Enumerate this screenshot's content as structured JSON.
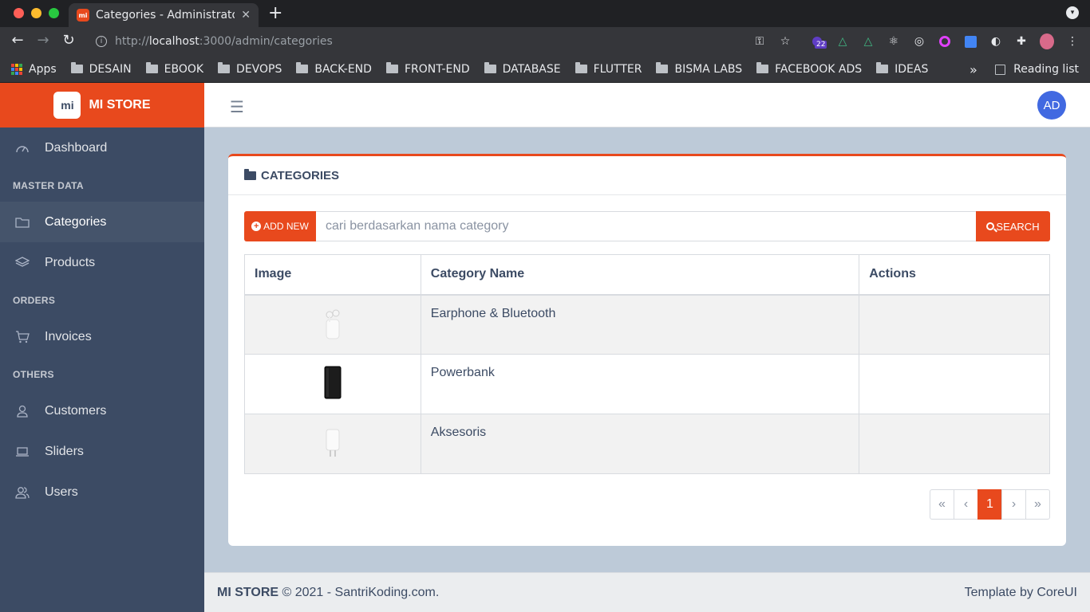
{
  "browser": {
    "tab_title": "Categories - Administrator",
    "tab_favicon": "mi",
    "url_protocol": "http://",
    "url_host": "localhost",
    "url_path": ":3000/admin/categories",
    "extension_badge": "22",
    "bookmarks": [
      {
        "label": "Apps",
        "icon": "apps-grid-icon"
      },
      {
        "label": "DESAIN",
        "icon": "folder-icon"
      },
      {
        "label": "EBOOK",
        "icon": "folder-icon"
      },
      {
        "label": "DEVOPS",
        "icon": "folder-icon"
      },
      {
        "label": "BACK-END",
        "icon": "folder-icon"
      },
      {
        "label": "FRONT-END",
        "icon": "folder-icon"
      },
      {
        "label": "DATABASE",
        "icon": "folder-icon"
      },
      {
        "label": "FLUTTER",
        "icon": "folder-icon"
      },
      {
        "label": "BISMA LABS",
        "icon": "folder-icon"
      },
      {
        "label": "FACEBOOK ADS",
        "icon": "folder-icon"
      },
      {
        "label": "IDEAS",
        "icon": "folder-icon"
      }
    ],
    "more_bookmarks": "»",
    "reading_list": "Reading list"
  },
  "sidebar": {
    "brand_logo": "mi",
    "brand": "MI STORE",
    "dashboard": "Dashboard",
    "section_master": "MASTER DATA",
    "categories": "Categories",
    "products": "Products",
    "section_orders": "ORDERS",
    "invoices": "Invoices",
    "section_others": "OTHERS",
    "customers": "Customers",
    "sliders": "Sliders",
    "users": "Users"
  },
  "header": {
    "menu_icon": "☰",
    "avatar_initials": "AD"
  },
  "card": {
    "title": "CATEGORIES",
    "add_button": "ADD NEW",
    "search_placeholder": "cari berdasarkan nama category",
    "search_button": "SEARCH",
    "columns": [
      "Image",
      "Category Name",
      "Actions"
    ],
    "rows": [
      {
        "image": "earphone-product-image",
        "name": "Earphone & Bluetooth",
        "actions": ""
      },
      {
        "image": "powerbank-product-image",
        "name": "Powerbank",
        "actions": ""
      },
      {
        "image": "charger-product-image",
        "name": "Aksesoris",
        "actions": ""
      }
    ],
    "pagination": {
      "first": "«",
      "prev": "‹",
      "current": "1",
      "next": "›",
      "last": "»"
    }
  },
  "footer": {
    "brand": "MI STORE",
    "copyright": "© 2021 - SantriKoding.com.",
    "template_by": "Template by",
    "template_link": "CoreUI"
  },
  "colors": {
    "accent": "#e8491d",
    "sidebar": "#3c4b64",
    "background": "#bdcad8",
    "avatar": "#4169e1"
  }
}
